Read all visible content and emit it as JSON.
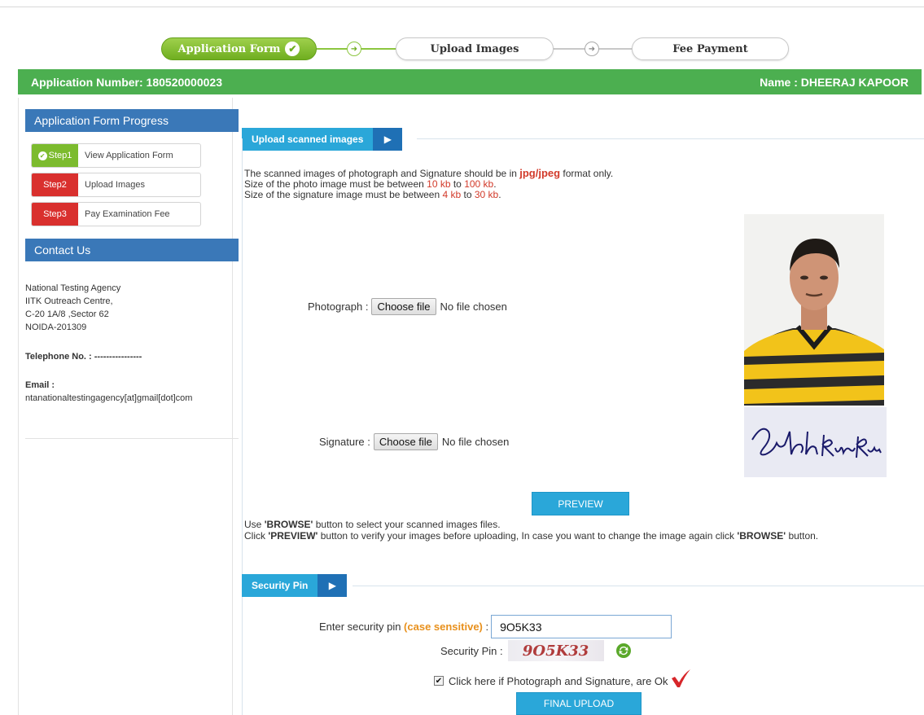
{
  "steps": {
    "application_form": "Application Form",
    "upload_images": "Upload Images",
    "fee_payment": "Fee Payment"
  },
  "header": {
    "application_number": "Application Number: 180520000023",
    "name": "Name : DHEERAJ KAPOOR"
  },
  "sidebar": {
    "progress_title": "Application Form Progress",
    "items": [
      {
        "badge": "Step1",
        "label": "View Application Form",
        "status": "done"
      },
      {
        "badge": "Step2",
        "label": "Upload Images",
        "status": "pending"
      },
      {
        "badge": "Step3",
        "label": "Pay Examination Fee",
        "status": "pending"
      }
    ],
    "contact_title": "Contact Us",
    "address": [
      "National Testing Agency",
      "IITK Outreach Centre,",
      "C-20 1A/8 ,Sector 62",
      "NOIDA-201309"
    ],
    "telephone": "Telephone No. : ----------------",
    "email_label": "Email :",
    "email": "ntanationaltestingagency[at]gmail[dot]com"
  },
  "upload": {
    "section_title": "Upload scanned images",
    "line1_a": "The scanned images of photograph and Signature should be in ",
    "line1_b": "jpg/jpeg",
    "line1_c": " format only.",
    "line2_a": "Size of the photo image must be between ",
    "line2_b": "10 kb",
    "line2_c": " to ",
    "line2_d": "100 kb",
    "line2_e": ".",
    "line3_a": "Size of the signature image must be between ",
    "line3_b": "4 kb",
    "line3_c": " to ",
    "line3_d": "30 kb",
    "line3_e": ".",
    "photo_label": "Photograph :",
    "signature_label": "Signature :",
    "choose_file": "Choose file",
    "no_file": "No file chosen",
    "preview_button": "PREVIEW",
    "note1_a": "Use ",
    "note1_b": "'BROWSE'",
    "note1_c": " button to select your scanned images files.",
    "note2_a": "Click ",
    "note2_b": "'PREVIEW'",
    "note2_c": " button to verify your images before uploading, In case you want to change the image again click ",
    "note2_d": "'BROWSE'",
    "note2_e": " button."
  },
  "security": {
    "section_title": "Security Pin",
    "enter_label": "Enter security pin ",
    "case_sensitive": "(case sensitive)",
    "colon": " :",
    "pin_value": "9O5K33",
    "security_pin_label": "Security Pin :",
    "captcha": "9O5K33",
    "checkbox_label": "Click here if Photograph and Signature, are Ok",
    "checkbox_checked": true,
    "final_button": "FINAL UPLOAD"
  },
  "colors": {
    "green": "#4caf50",
    "blue": "#2aa7d9",
    "dark_blue": "#1f70b5",
    "sidebar_blue": "#3a78b8",
    "red": "#d9302e"
  }
}
